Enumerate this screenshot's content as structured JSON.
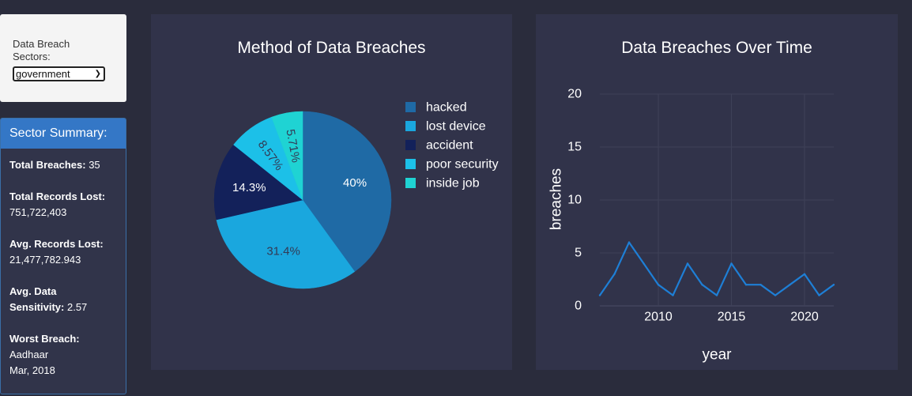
{
  "filter": {
    "label": "Data Breach Sectors:",
    "selected": "government"
  },
  "summary": {
    "header": "Sector Summary:",
    "total_breaches_label": "Total Breaches:",
    "total_breaches_value": "35",
    "total_records_label": "Total Records Lost:",
    "total_records_value": "751,722,403",
    "avg_records_label": "Avg. Records Lost:",
    "avg_records_value": "21,477,782.943",
    "avg_sensitivity_label": "Avg. Data Sensitivity:",
    "avg_sensitivity_value": "2.57",
    "worst_label": "Worst Breach:",
    "worst_name": "Aadhaar",
    "worst_date": "Mar, 2018"
  },
  "colors": {
    "background": "#2a2c3c",
    "panel": "#31334a",
    "accent": "#3477c6",
    "line": "#1e7fd6"
  },
  "chart_data": [
    {
      "type": "pie",
      "title": "Method of Data Breaches",
      "legend_position": "right",
      "slices": [
        {
          "label": "hacked",
          "value": 40,
          "text": "40%",
          "color": "#1f6aa5"
        },
        {
          "label": "lost device",
          "value": 31.4,
          "text": "31.4%",
          "color": "#1aa7de"
        },
        {
          "label": "accident",
          "value": 14.3,
          "text": "14.3%",
          "color": "#13215a"
        },
        {
          "label": "poor security",
          "value": 8.57,
          "text": "8.57%",
          "color": "#1cc0e8"
        },
        {
          "label": "inside job",
          "value": 5.71,
          "text": "5.71%",
          "color": "#1fd3d3"
        }
      ]
    },
    {
      "type": "line",
      "title": "Data Breaches Over Time",
      "xlabel": "year",
      "ylabel": "breaches",
      "xlim": [
        2006,
        2022
      ],
      "ylim": [
        0,
        20
      ],
      "xticks": [
        2010,
        2015,
        2020
      ],
      "yticks": [
        0,
        5,
        10,
        15,
        20
      ],
      "grid": true,
      "series": [
        {
          "x": [
            2006,
            2007,
            2008,
            2009,
            2010,
            2011,
            2012,
            2013,
            2014,
            2015,
            2016,
            2017,
            2018,
            2019,
            2020,
            2021,
            2022
          ],
          "y": [
            1,
            3,
            6,
            4,
            2,
            1,
            4,
            2,
            1,
            4,
            2,
            2,
            1,
            2,
            3,
            1,
            2
          ]
        }
      ]
    }
  ]
}
